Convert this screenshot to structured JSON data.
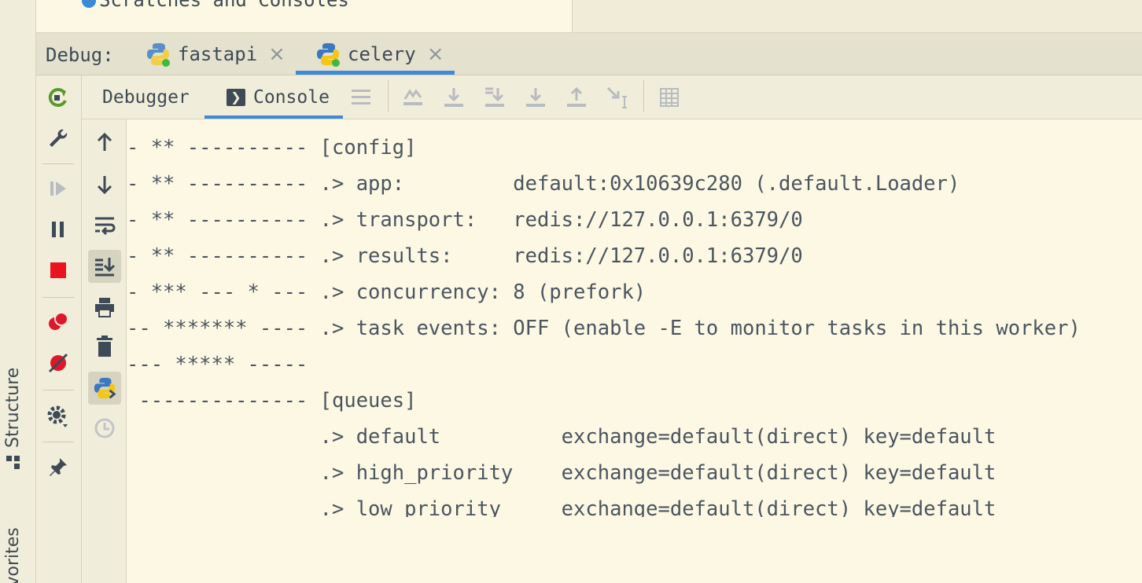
{
  "left_strip": {
    "structure_label": "Structure",
    "favorites_label": "avorites"
  },
  "top_remnant": {
    "text": "Scratches and Consoles"
  },
  "debug_header": {
    "label": "Debug:",
    "tabs": [
      {
        "label": "fastapi",
        "icon": "python-icon",
        "active": false
      },
      {
        "label": "celery",
        "icon": "python-icon",
        "active": true
      }
    ]
  },
  "sub_header": {
    "tabs": [
      {
        "label": "Debugger",
        "active": false
      },
      {
        "label": "Console",
        "active": true
      }
    ]
  },
  "console": {
    "lines": [
      "- ** ---------- [config]",
      "- ** ---------- .> app:         default:0x10639c280 (.default.Loader)",
      "- ** ---------- .> transport:   redis://127.0.0.1:6379/0",
      "- ** ---------- .> results:     redis://127.0.0.1:6379/0",
      "- *** --- * --- .> concurrency: 8 (prefork)",
      "-- ******* ---- .> task events: OFF (enable -E to monitor tasks in this worker)",
      "--- ***** -----",
      " -------------- [queues]",
      "                .> default          exchange=default(direct) key=default",
      "                .> high_priority    exchange=default(direct) key=default",
      "                .> low_priority     exchange=default(direct) key=default"
    ]
  },
  "colors": {
    "accent": "#3d8ad9",
    "stop_red": "#e8141e",
    "rerun_green": "#5a9a2a",
    "console_bg": "#fdf8e4"
  }
}
